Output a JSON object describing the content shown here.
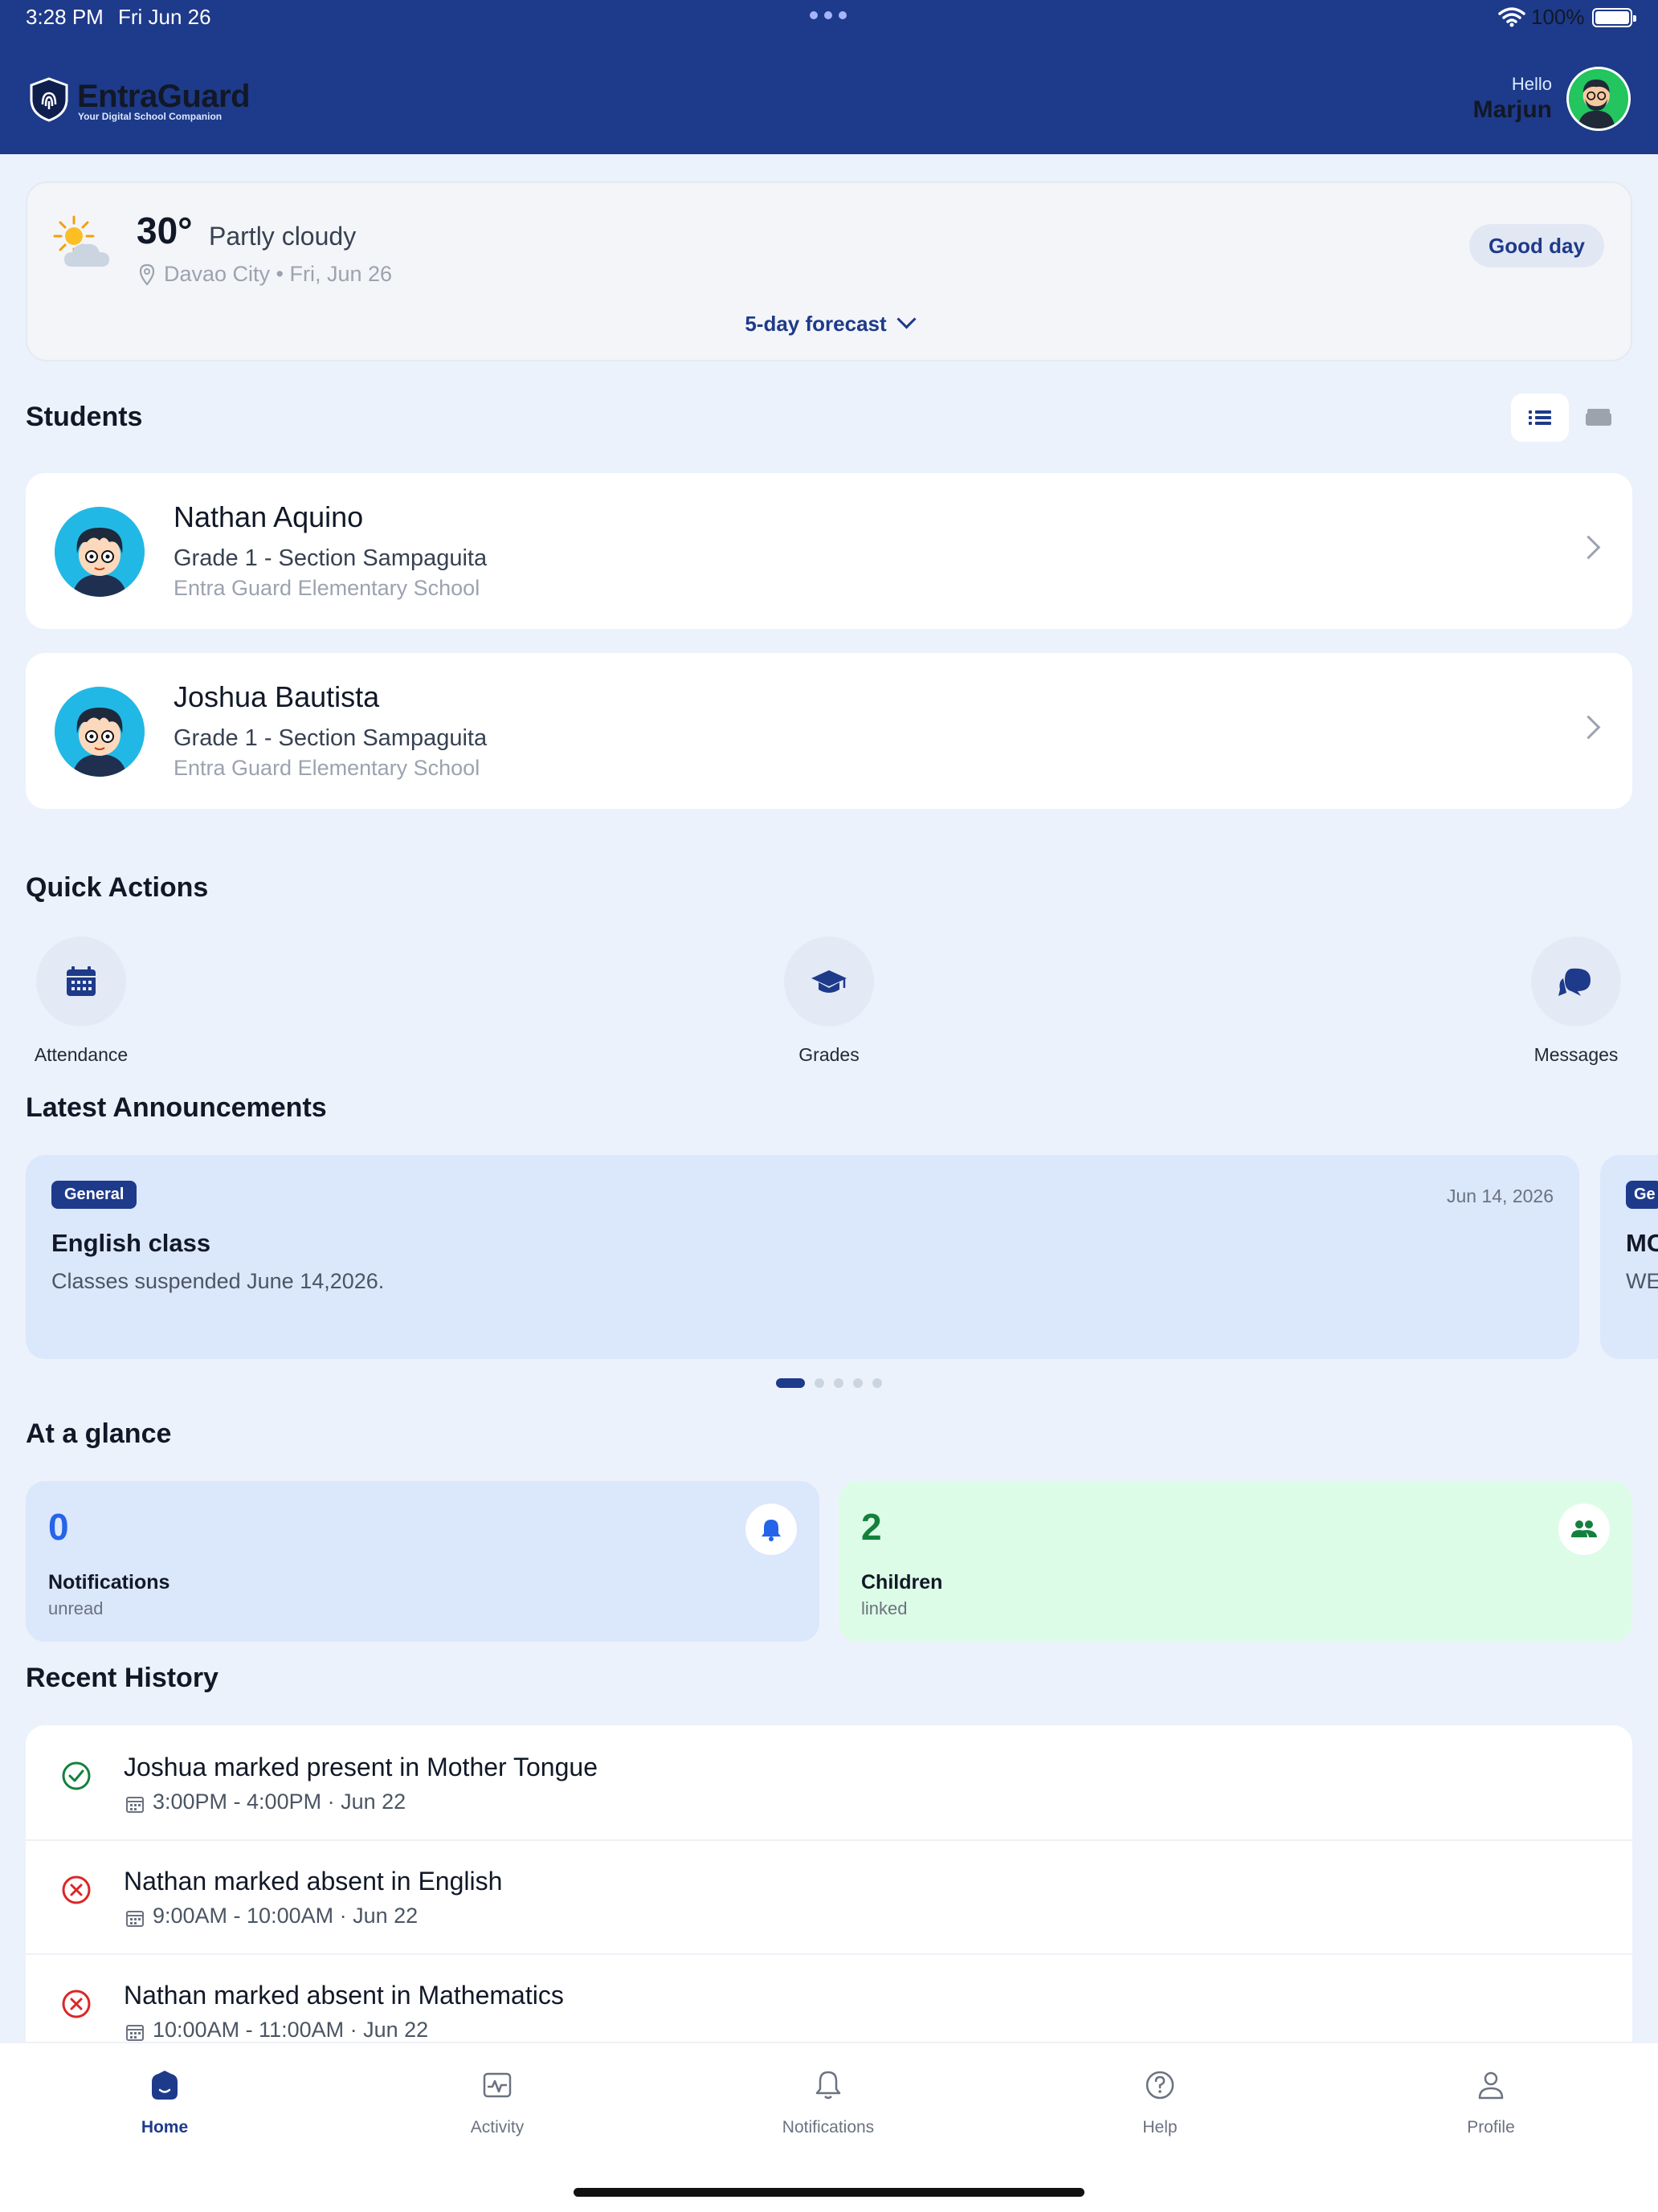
{
  "status_bar": {
    "time": "3:28 PM",
    "date": "Fri Jun 26",
    "battery": "100%"
  },
  "header": {
    "brand": "EntraGuard",
    "tagline": "Your Digital School Companion",
    "greeting": "Hello",
    "user_name": "Marjun",
    "accent_color": "#1e3a8a"
  },
  "weather": {
    "temperature": "30°",
    "condition": "Partly cloudy",
    "location": "Davao City • Fri, Jun 26",
    "greeting_badge": "Good day",
    "forecast_link": "5-day forecast",
    "icon": "partly-cloudy-icon"
  },
  "students": {
    "title": "Students",
    "items": [
      {
        "name": "Nathan Aquino",
        "grade": "Grade 1 - Section Sampaguita",
        "school": "Entra Guard Elementary School"
      },
      {
        "name": "Joshua Bautista",
        "grade": "Grade 1 - Section Sampaguita",
        "school": "Entra Guard Elementary School"
      }
    ]
  },
  "quick_actions": {
    "title": "Quick Actions",
    "items": [
      {
        "label": "Attendance",
        "icon": "calendar-icon"
      },
      {
        "label": "Grades",
        "icon": "graduation-cap-icon"
      },
      {
        "label": "Messages",
        "icon": "chat-bubbles-icon"
      }
    ]
  },
  "announcements": {
    "title": "Latest Announcements",
    "items": [
      {
        "category": "General",
        "date": "Jun 14, 2026",
        "heading": "English class",
        "body": "Classes suspended June 14,2026."
      },
      {
        "category": "Ge",
        "heading": "MC",
        "body": "WE"
      }
    ],
    "page_count": 5,
    "active_page": 1
  },
  "glance": {
    "title": "At a glance",
    "notifications": {
      "count": "0",
      "label": "Notifications",
      "sub": "unread",
      "color": "#2563eb",
      "bg": "#dbe7fb"
    },
    "children": {
      "count": "2",
      "label": "Children",
      "sub": "linked",
      "color": "#15803d",
      "bg": "#dcfce7"
    }
  },
  "history": {
    "title": "Recent History",
    "items": [
      {
        "status": "present",
        "text": "Joshua marked present in Mother Tongue",
        "time": "3:00PM - 4:00PM  ·  Jun 22"
      },
      {
        "status": "absent",
        "text": "Nathan marked absent in English",
        "time": "9:00AM - 10:00AM  ·  Jun 22"
      },
      {
        "status": "absent",
        "text": "Nathan marked absent in Mathematics",
        "time": "10:00AM - 11:00AM  ·  Jun 22"
      }
    ],
    "present_color": "#15803d",
    "absent_color": "#dc2626"
  },
  "nav": {
    "items": [
      {
        "label": "Home",
        "icon": "home-icon",
        "active": true
      },
      {
        "label": "Activity",
        "icon": "activity-icon"
      },
      {
        "label": "Notifications",
        "icon": "bell-icon"
      },
      {
        "label": "Help",
        "icon": "help-icon"
      },
      {
        "label": "Profile",
        "icon": "user-icon"
      }
    ]
  }
}
